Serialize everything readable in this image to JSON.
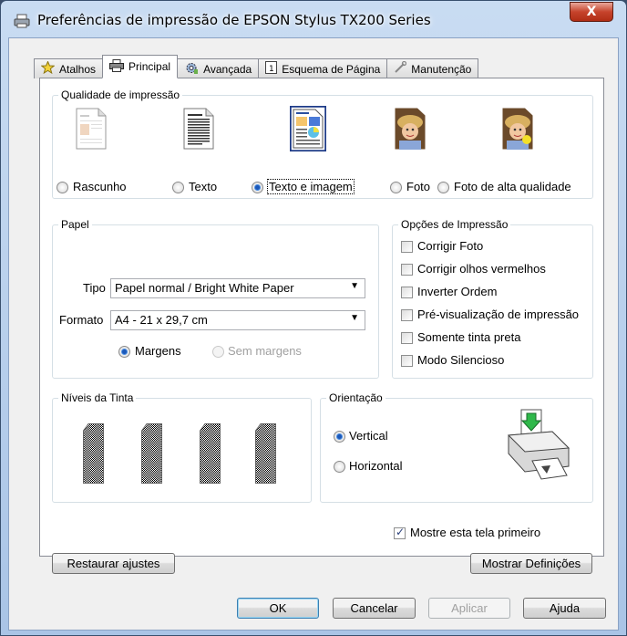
{
  "window": {
    "title": "Preferências de impressão de EPSON Stylus TX200 Series",
    "close_label": "X"
  },
  "tabs": [
    {
      "label": "Atalhos",
      "icon": "star-icon"
    },
    {
      "label": "Principal",
      "icon": "printer-icon"
    },
    {
      "label": "Avançada",
      "icon": "gear-icon"
    },
    {
      "label": "Esquema de Página",
      "icon": "page-layout-icon"
    },
    {
      "label": "Manutenção",
      "icon": "wrench-icon"
    }
  ],
  "quality": {
    "title": "Qualidade de impressão",
    "options": [
      {
        "label": "Rascunho",
        "selected": false
      },
      {
        "label": "Texto",
        "selected": false
      },
      {
        "label": "Texto e imagem",
        "selected": true
      },
      {
        "label": "Foto",
        "selected": false
      },
      {
        "label": "Foto de alta qualidade",
        "selected": false
      }
    ]
  },
  "paper": {
    "title": "Papel",
    "type_label": "Tipo",
    "type_value": "Papel normal / Bright White Paper",
    "format_label": "Formato",
    "format_value": "A4 - 21 x 29,7 cm",
    "margins_label": "Margens",
    "no_margins_label": "Sem margens"
  },
  "print_options": {
    "title": "Opções de Impressão",
    "items": [
      {
        "label": "Corrigir Foto",
        "checked": false
      },
      {
        "label": "Corrigir olhos vermelhos",
        "checked": false
      },
      {
        "label": "Inverter Ordem",
        "checked": false
      },
      {
        "label": "Pré-visualização de impressão",
        "checked": false
      },
      {
        "label": "Somente tinta preta",
        "checked": false
      },
      {
        "label": "Modo Silencioso",
        "checked": false
      }
    ]
  },
  "ink": {
    "title": "Níveis da Tinta"
  },
  "orientation": {
    "title": "Orientação",
    "vertical_label": "Vertical",
    "horizontal_label": "Horizontal"
  },
  "show_first": {
    "label": "Mostre esta tela primeiro",
    "checked": true
  },
  "buttons": {
    "restore": "Restaurar ajustes",
    "show_settings": "Mostrar Definições",
    "ok": "OK",
    "cancel": "Cancelar",
    "apply": "Aplicar",
    "help": "Ajuda"
  }
}
